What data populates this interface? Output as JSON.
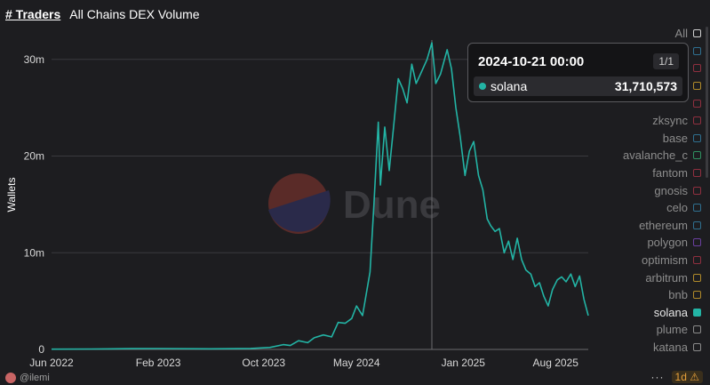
{
  "header": {
    "brand": "# Traders",
    "title": "All Chains DEX Volume"
  },
  "watermark": "Dune",
  "footer": {
    "user": "@ilemi",
    "more": "···",
    "interval": "1d",
    "warning_icon": "warning-icon"
  },
  "tooltip": {
    "date": "2024-10-21 00:00",
    "page": "1/1",
    "series": "solana",
    "value": "31,710,573",
    "color": "#23b4a5"
  },
  "legend": [
    {
      "label": "All",
      "color": "#d0d0d0",
      "active": false
    },
    {
      "label": "",
      "color": "#2f6f8f",
      "active": false
    },
    {
      "label": "",
      "color": "#8f2f3f",
      "active": false
    },
    {
      "label": "",
      "color": "#b08a2a",
      "active": false
    },
    {
      "label": "",
      "color": "#8f2f3f",
      "active": false
    },
    {
      "label": "zksync",
      "color": "#8f2f3f",
      "active": false
    },
    {
      "label": "base",
      "color": "#2f6f8f",
      "active": false
    },
    {
      "label": "avalanche_c",
      "color": "#2f8f5f",
      "active": false
    },
    {
      "label": "fantom",
      "color": "#8f2f3f",
      "active": false
    },
    {
      "label": "gnosis",
      "color": "#8f2f3f",
      "active": false
    },
    {
      "label": "celo",
      "color": "#2f6f8f",
      "active": false
    },
    {
      "label": "ethereum",
      "color": "#2f6f8f",
      "active": false
    },
    {
      "label": "polygon",
      "color": "#6a3f9f",
      "active": false
    },
    {
      "label": "optimism",
      "color": "#8f2f3f",
      "active": false
    },
    {
      "label": "arbitrum",
      "color": "#b08a2a",
      "active": false
    },
    {
      "label": "bnb",
      "color": "#b08a2a",
      "active": false
    },
    {
      "label": "solana",
      "color": "#23b4a5",
      "active": true
    },
    {
      "label": "plume",
      "color": "#8a8a8a",
      "active": false
    },
    {
      "label": "katana",
      "color": "#8a8a8a",
      "active": false
    }
  ],
  "chart_data": {
    "type": "line",
    "ylabel": "Wallets",
    "xlabel": "",
    "x_ticks": [
      "Jun 2022",
      "Feb 2023",
      "Oct 2023",
      "May 2024",
      "Jan 2025",
      "Aug 2025"
    ],
    "y_ticks": [
      "0",
      "10m",
      "20m",
      "30m"
    ],
    "ylim": [
      0,
      32000000
    ],
    "grid": true,
    "series": [
      {
        "name": "solana",
        "color": "#23b4a5",
        "points": [
          [
            "2022-06-01",
            30000
          ],
          [
            "2022-09-01",
            50000
          ],
          [
            "2022-12-01",
            80000
          ],
          [
            "2023-02-01",
            90000
          ],
          [
            "2023-06-01",
            60000
          ],
          [
            "2023-09-01",
            100000
          ],
          [
            "2023-10-15",
            200000
          ],
          [
            "2023-11-15",
            500000
          ],
          [
            "2023-12-01",
            400000
          ],
          [
            "2023-12-20",
            900000
          ],
          [
            "2024-01-10",
            700000
          ],
          [
            "2024-01-25",
            1200000
          ],
          [
            "2024-02-15",
            1500000
          ],
          [
            "2024-03-05",
            1300000
          ],
          [
            "2024-03-20",
            2800000
          ],
          [
            "2024-04-05",
            2700000
          ],
          [
            "2024-04-20",
            3200000
          ],
          [
            "2024-05-01",
            4500000
          ],
          [
            "2024-05-15",
            3500000
          ],
          [
            "2024-06-01",
            8000000
          ],
          [
            "2024-06-10",
            15000000
          ],
          [
            "2024-06-20",
            23500000
          ],
          [
            "2024-06-25",
            17000000
          ],
          [
            "2024-07-05",
            23000000
          ],
          [
            "2024-07-15",
            18500000
          ],
          [
            "2024-07-25",
            23000000
          ],
          [
            "2024-08-05",
            28000000
          ],
          [
            "2024-08-15",
            27000000
          ],
          [
            "2024-08-25",
            25500000
          ],
          [
            "2024-09-05",
            29500000
          ],
          [
            "2024-09-15",
            27500000
          ],
          [
            "2024-09-25",
            28500000
          ],
          [
            "2024-10-10",
            30000000
          ],
          [
            "2024-10-21",
            31710573
          ],
          [
            "2024-10-30",
            27500000
          ],
          [
            "2024-11-10",
            28500000
          ],
          [
            "2024-11-25",
            31000000
          ],
          [
            "2024-12-05",
            29000000
          ],
          [
            "2024-12-15",
            25000000
          ],
          [
            "2024-12-25",
            22000000
          ],
          [
            "2025-01-05",
            18000000
          ],
          [
            "2025-01-15",
            20500000
          ],
          [
            "2025-01-25",
            21500000
          ],
          [
            "2025-02-05",
            18000000
          ],
          [
            "2025-02-15",
            16500000
          ],
          [
            "2025-02-25",
            13500000
          ],
          [
            "2025-03-05",
            12800000
          ],
          [
            "2025-03-15",
            12200000
          ],
          [
            "2025-03-25",
            12500000
          ],
          [
            "2025-04-05",
            10000000
          ],
          [
            "2025-04-15",
            11200000
          ],
          [
            "2025-04-25",
            9300000
          ],
          [
            "2025-05-05",
            11500000
          ],
          [
            "2025-05-15",
            9300000
          ],
          [
            "2025-05-25",
            8200000
          ],
          [
            "2025-06-05",
            7800000
          ],
          [
            "2025-06-15",
            6500000
          ],
          [
            "2025-06-25",
            6900000
          ],
          [
            "2025-07-05",
            5500000
          ],
          [
            "2025-07-15",
            4500000
          ],
          [
            "2025-07-25",
            6200000
          ],
          [
            "2025-08-05",
            7200000
          ],
          [
            "2025-08-15",
            7500000
          ],
          [
            "2025-08-25",
            7000000
          ],
          [
            "2025-09-05",
            7800000
          ],
          [
            "2025-09-15",
            6500000
          ],
          [
            "2025-09-25",
            7600000
          ],
          [
            "2025-10-05",
            5200000
          ],
          [
            "2025-10-15",
            3500000
          ]
        ]
      }
    ],
    "crosshair_x": "2024-10-21"
  }
}
